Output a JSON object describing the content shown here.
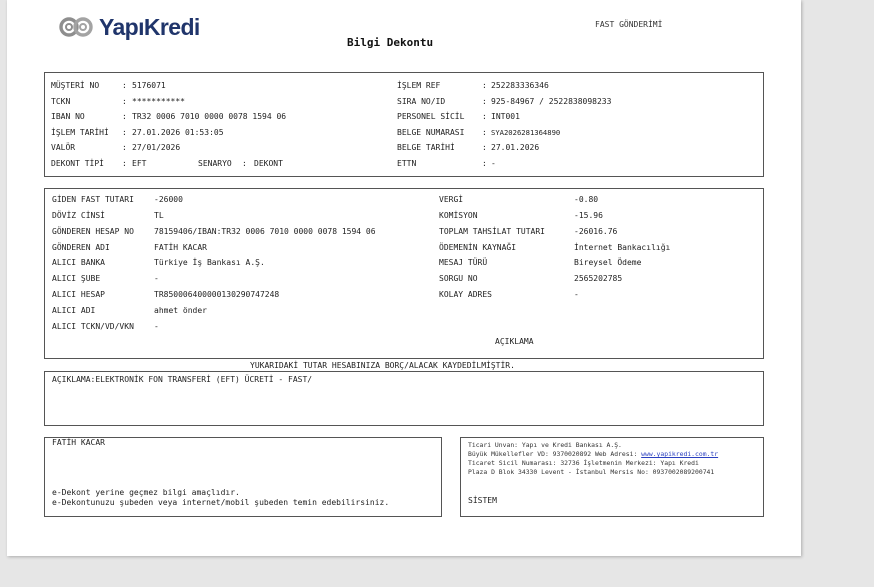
{
  "header": {
    "brand": "YapıKredi",
    "fast_label": "FAST GÖNDERİMİ",
    "title": "Bilgi Dekontu"
  },
  "info_left": [
    {
      "label": "MÜŞTERİ NO",
      "value": "5176071"
    },
    {
      "label": "TCKN",
      "value": "***********"
    },
    {
      "label": "IBAN NO",
      "value": "TR32 0006 7010 0000 0078 1594 06"
    },
    {
      "label": "İŞLEM TARİHİ",
      "value": "27.01.2026 01:53:05"
    },
    {
      "label": "VALÖR",
      "value": "27/01/2026"
    },
    {
      "label": "DEKONT TİPİ",
      "value": "EFT"
    }
  ],
  "senaryo": {
    "label": "SENARYO",
    "value": "DEKONT"
  },
  "info_right": [
    {
      "label": "İŞLEM REF",
      "value": "252283336346"
    },
    {
      "label": "SIRA NO/ID",
      "value": "925-84967 / 2522838098233"
    },
    {
      "label": "PERSONEL SİCİL",
      "value": "INT001"
    },
    {
      "label": "BELGE NUMARASI",
      "value": "SYA2026281364890"
    },
    {
      "label": "BELGE TARİHİ",
      "value": "27.01.2026"
    },
    {
      "label": "ETTN",
      "value": "-"
    }
  ],
  "tx_left": [
    {
      "label": "GİDEN FAST TUTARI",
      "value": "-26000"
    },
    {
      "label": "DÖVİZ CİNSİ",
      "value": "TL"
    },
    {
      "label": "GÖNDEREN HESAP NO",
      "value": "78159406/IBAN:TR32 0006 7010 0000 0078 1594 06"
    },
    {
      "label": "GÖNDEREN ADI",
      "value": "FATİH KACAR"
    },
    {
      "label": "ALICI BANKA",
      "value": "Türkiye İş Bankası A.Ş."
    },
    {
      "label": "ALICI ŞUBE",
      "value": "-"
    },
    {
      "label": "ALICI HESAP",
      "value": "TR850006400000130290747248"
    },
    {
      "label": "ALICI ADI",
      "value": "ahmet önder"
    },
    {
      "label": "ALICI TCKN/VD/VKN",
      "value": "-"
    }
  ],
  "tx_right": [
    {
      "label": "VERGİ",
      "value": "-0.80"
    },
    {
      "label": "KOMİSYON",
      "value": "-15.96"
    },
    {
      "label": "TOPLAM TAHSİLAT TUTARI",
      "value": "-26016.76"
    },
    {
      "label": "ÖDEMENİN KAYNAĞI",
      "value": "İnternet Bankacılığı"
    },
    {
      "label": "MESAJ TÜRÜ",
      "value": "Bireysel Ödeme"
    },
    {
      "label": "SORGU NO",
      "value": "2565202785"
    },
    {
      "label": "KOLAY ADRES",
      "value": "-"
    }
  ],
  "aciklama_heading": "AÇIKLAMA",
  "notice": "YUKARIDAKİ TUTAR HESABINIZA BORÇ/ALACAK KAYDEDİLMİŞTİR.",
  "description": "AÇIKLAMA:ELEKTRONİK FON TRANSFERİ (EFT) ÜCRETİ - FAST/",
  "footer_left": {
    "name": "FATİH KACAR",
    "line1": "e-Dekont yerine geçmez bilgi amaçlıdır.",
    "line2": "e-Dekontunuzu şubeden veya internet/mobil şubeden temin edebilirsiniz."
  },
  "footer_right": {
    "line1": "Ticari Unvan: Yapı ve Kredi Bankası A.Ş.",
    "line2_prefix": "Büyük Mükellefler VD: 9370020892 Web Adresi:",
    "line2_link": "www.yapikredi.com.tr",
    "line3": "Ticaret Sicil Numarası: 32736 İşletmenin Merkezi: Yapı Kredi",
    "line4": "Plaza D Blok 34330 Levent - İstanbul Mersis No: 0937002089200741",
    "sistem": "SİSTEM"
  },
  "colors": {
    "brand": "#20356b",
    "page": "#ffffff",
    "background": "#e6e6e6"
  },
  "icons": {
    "brand_mark": "yapikredi-logo-icon"
  }
}
